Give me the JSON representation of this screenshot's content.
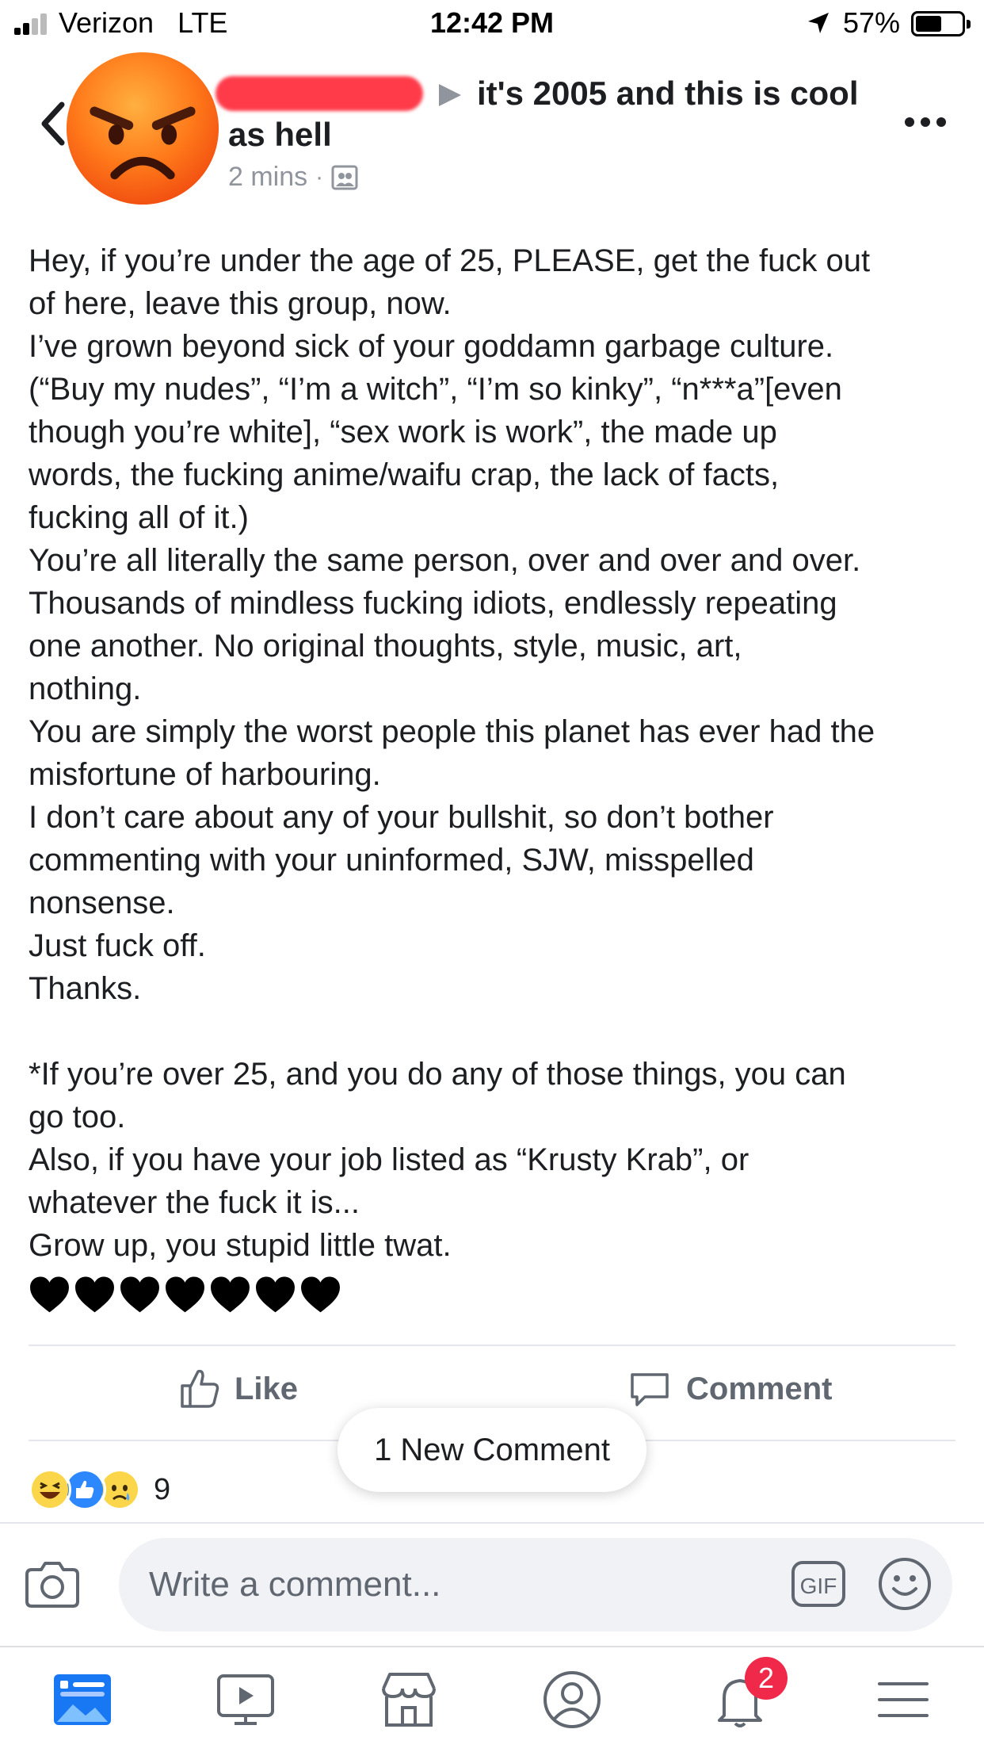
{
  "status_bar": {
    "carrier": "Verizon",
    "network": "LTE",
    "time": "12:42 PM",
    "battery": "57%",
    "battery_level": 0.57
  },
  "post": {
    "group_name_line1": "it's 2005 and this is cool",
    "group_name_line2": "as hell",
    "time_ago": "2 mins",
    "separator": "·",
    "audience_icon": "group-audience-icon",
    "body_lines": [
      "Hey, if you’re under the age of 25, PLEASE, get the fuck out",
      "of here, leave this group, now.",
      "I’ve grown beyond sick of your goddamn garbage culture.",
      "(“Buy my nudes”, “I’m a witch”, “I’m so kinky”, “n***a”[even",
      "though you’re white], “sex work is work”, the made up",
      "words, the fucking anime/waifu crap, the lack of facts,",
      "fucking all of it.)",
      "You’re all literally the same person, over and over and over.",
      "Thousands of mindless fucking idiots, endlessly repeating",
      "one another.  No original thoughts, style, music, art,",
      "nothing.",
      "You are simply the worst people this planet has ever had the",
      "misfortune of harbouring.",
      "I don’t care about any of your bullshit, so don’t bother",
      "commenting with your uninformed, SJW, misspelled",
      "nonsense.",
      "Just fuck off.",
      "Thanks.",
      "",
      "*If you’re over 25, and you do any of those things, you can",
      "go too.",
      "Also, if you have your job listed as “Krusty Krab”, or",
      "whatever the fuck it is...",
      "Grow up, you stupid little twat."
    ],
    "hearts": "🖤🖤🖤🖤🖤🖤🖤",
    "heart_count": 7
  },
  "actions": {
    "like_label": "Like",
    "comment_label": "Comment",
    "new_comment_pill": "1 New Comment",
    "reaction_count": "9",
    "reaction_types": [
      "haha",
      "like",
      "sad"
    ]
  },
  "composer": {
    "placeholder": "Write a comment...",
    "gif_label": "GIF"
  },
  "tab_bar": {
    "tabs": [
      "news-feed",
      "watch",
      "marketplace",
      "profile",
      "notifications",
      "menu"
    ],
    "notifications_badge": "2"
  },
  "colors": {
    "text": "#1c1e21",
    "secondary": "#606770",
    "facebook_blue": "#1877f2",
    "badge_red": "#f02849"
  }
}
